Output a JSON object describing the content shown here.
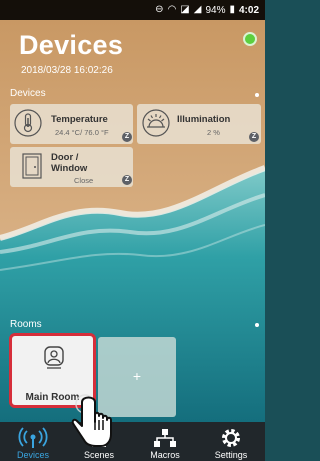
{
  "status_bar": {
    "battery": "94%",
    "time": "4:02"
  },
  "header": {
    "title": "Devices",
    "datetime": "2018/03/28 16:02:26",
    "online_color": "#5ccf3e"
  },
  "devices_section": {
    "label": "Devices",
    "items": [
      {
        "name": "Temperature",
        "value": "24.4 °C/ 76.0 °F",
        "icon": "thermometer-icon",
        "badge": "Z"
      },
      {
        "name": "Illumination",
        "value": "2 %",
        "icon": "sun-icon",
        "badge": "Z"
      },
      {
        "name_line1": "Door /",
        "name_line2": "Window",
        "value": "Close",
        "icon": "door-icon",
        "badge": "Z"
      }
    ]
  },
  "rooms_section": {
    "label": "Rooms",
    "rooms": [
      {
        "name": "Main Room",
        "icon": "room-icon"
      }
    ],
    "add_label": "+"
  },
  "nav": {
    "items": [
      {
        "label": "Devices",
        "icon": "wireless-icon",
        "active": true
      },
      {
        "label": "Scenes",
        "icon": "scenes-icon",
        "active": false
      },
      {
        "label": "Macros",
        "icon": "macros-icon",
        "active": false
      },
      {
        "label": "Settings",
        "icon": "gear-icon",
        "active": false
      }
    ],
    "active_color": "#3aa5e0"
  }
}
